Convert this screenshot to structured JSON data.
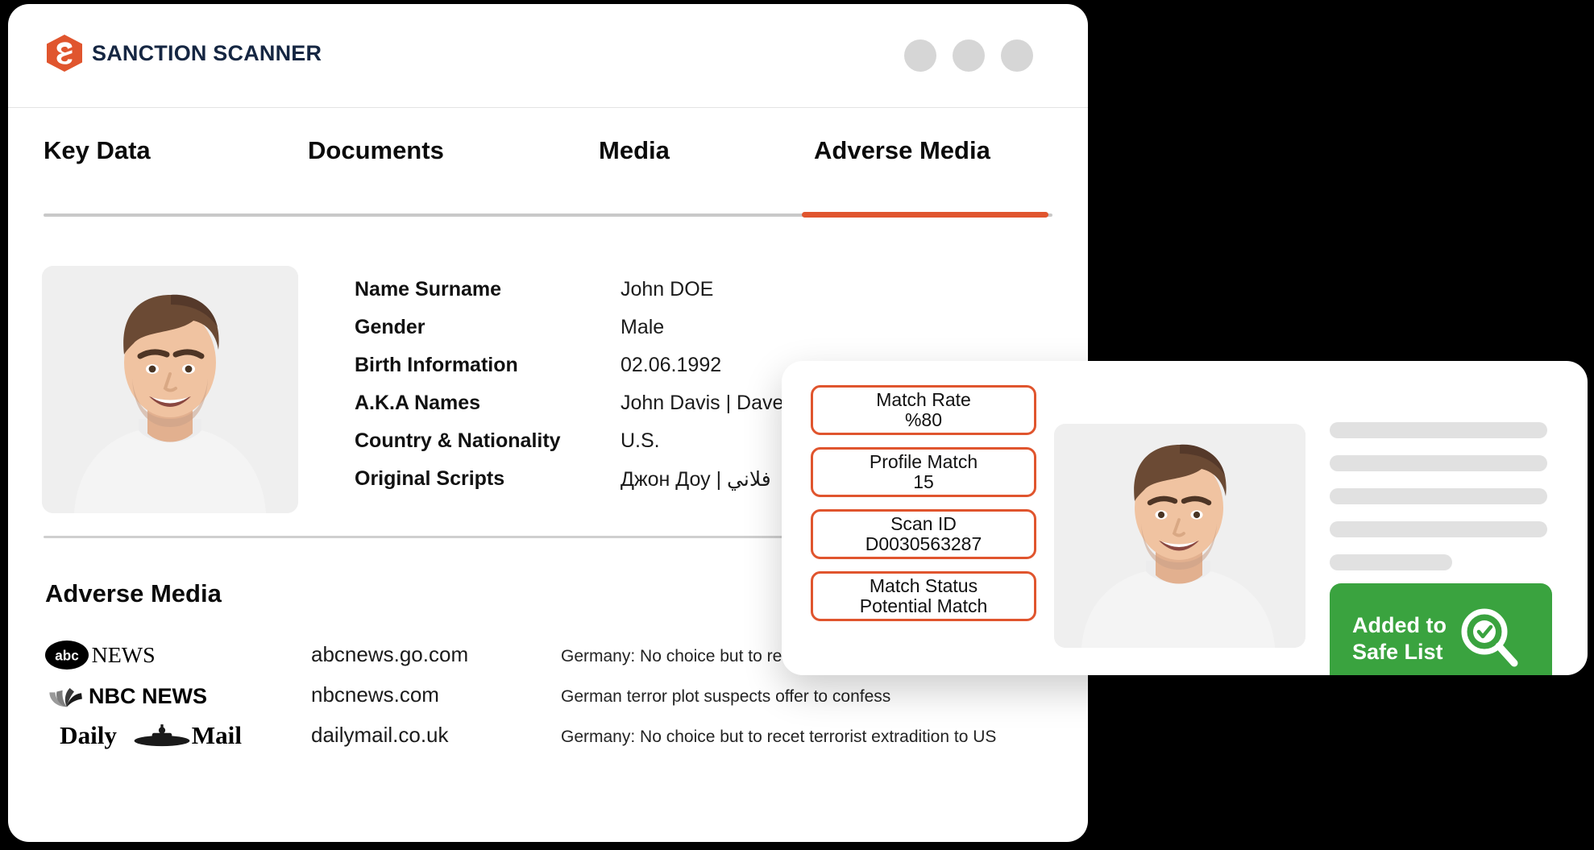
{
  "brand": {
    "name": "SANCTION SCANNER",
    "logo_icon": "sanction-scanner-hexagon-s-logo",
    "brand_color": "#e0552e",
    "text_color": "#152642"
  },
  "window_controls": {
    "dots": [
      "window-dot-1",
      "window-dot-2",
      "window-dot-3"
    ],
    "dot_color": "#d6d6d6"
  },
  "tabs": {
    "items": [
      {
        "label": "Key Data",
        "active": false
      },
      {
        "label": "Documents",
        "active": false
      },
      {
        "label": "Media",
        "active": false
      },
      {
        "label": "Adverse Media",
        "active": true
      }
    ],
    "active_color": "#e0552e",
    "inactive_rule_color": "#c9c9c9"
  },
  "profile": {
    "photo_alt": "profile-photo-smiling-man-white-sweatshirt",
    "fields": [
      {
        "label": "Name Surname",
        "value": "John DOE"
      },
      {
        "label": "Gender",
        "value": "Male"
      },
      {
        "label": "Birth Information",
        "value": "02.06.1992"
      },
      {
        "label": "A.K.A Names",
        "value": "John Davis  | Dave"
      },
      {
        "label": "Country & Nationality",
        "value": "U.S."
      },
      {
        "label": "Original Scripts",
        "value": "Джон Доу  |  فلاني"
      }
    ]
  },
  "adverse_media": {
    "title": "Adverse Media",
    "rows": [
      {
        "source": "abc NEWS",
        "source_logo": "abc-news-logo",
        "domain": "abcnews.go.com",
        "headline": "Germany: No choice but to recet terrorist extradition to US"
      },
      {
        "source": "NBC NEWS",
        "source_logo": "nbc-news-logo",
        "domain": "nbcnews.com",
        "headline": "German terror plot suspects offer to confess"
      },
      {
        "source": "Daily Mail",
        "source_logo": "daily-mail-logo",
        "domain": "dailymail.co.uk",
        "headline": "Germany: No choice but to recet terrorist extradition to US"
      }
    ]
  },
  "match_card": {
    "chips": [
      {
        "label": "Match Rate",
        "value": "%80"
      },
      {
        "label": "Profile Match",
        "value": "15"
      },
      {
        "label": "Scan ID",
        "value": "D0030563287"
      },
      {
        "label": "Match Status",
        "value": "Potential Match"
      }
    ],
    "chip_border_color": "#e0552e",
    "photo_alt": "match-photo-smiling-man-white-sweatshirt",
    "skeleton_lines": 5,
    "safe_button": {
      "line1": "Added to",
      "line2": "Safe List",
      "icon": "magnifier-check-icon",
      "color": "#3aa33f"
    }
  }
}
